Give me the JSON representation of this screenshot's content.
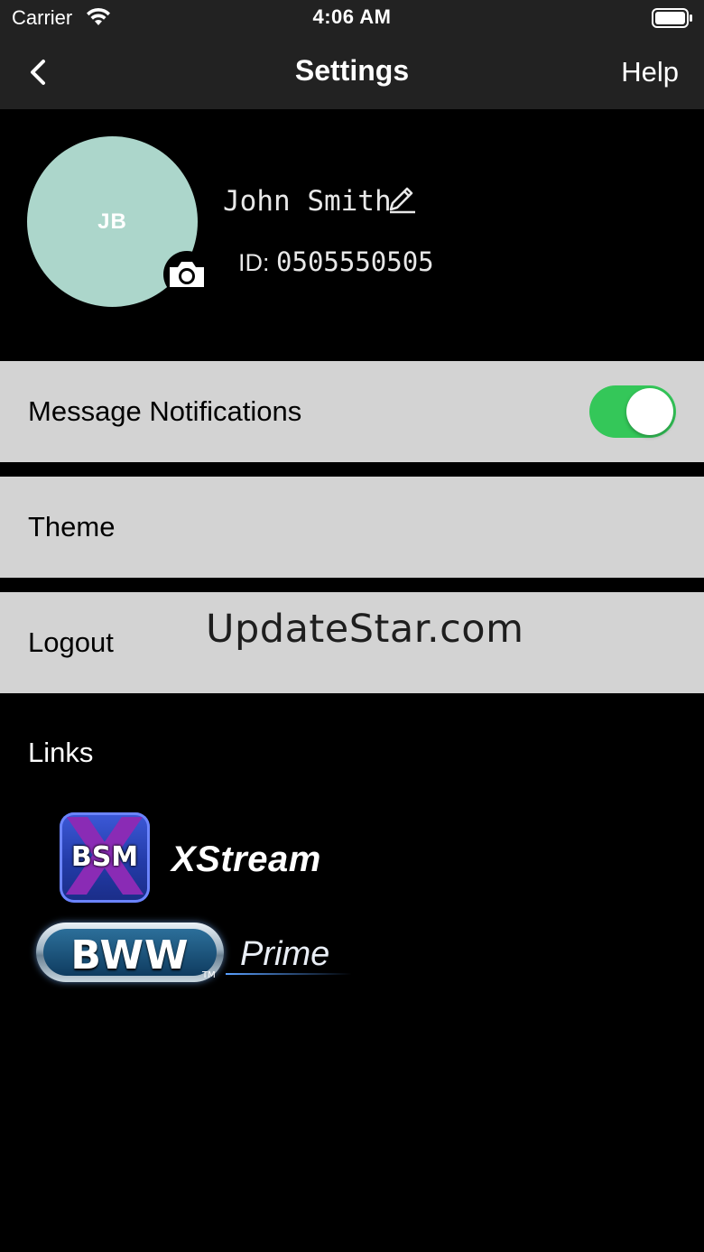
{
  "status_bar": {
    "carrier": "Carrier",
    "time": "4:06 AM"
  },
  "nav": {
    "title": "Settings",
    "help_label": "Help"
  },
  "profile": {
    "initials": "JB",
    "name": "John Smith",
    "id_label": "ID:",
    "id_value": "0505550505",
    "avatar_color": "#acd6cb"
  },
  "settings": {
    "notifications_label": "Message Notifications",
    "notifications_enabled": true,
    "theme_label": "Theme",
    "logout_label": "Logout"
  },
  "watermark": "UpdateStar.com",
  "links": {
    "title": "Links",
    "xstream": {
      "badge_text": "BSM",
      "badge_letter": "X",
      "name": "XStream"
    },
    "bww": {
      "badge_text": "BWW",
      "tm": "TM",
      "name": "Prime"
    }
  },
  "colors": {
    "toggle_on": "#34c759",
    "row_bg": "#d3d3d3",
    "bar_bg": "#222222"
  }
}
